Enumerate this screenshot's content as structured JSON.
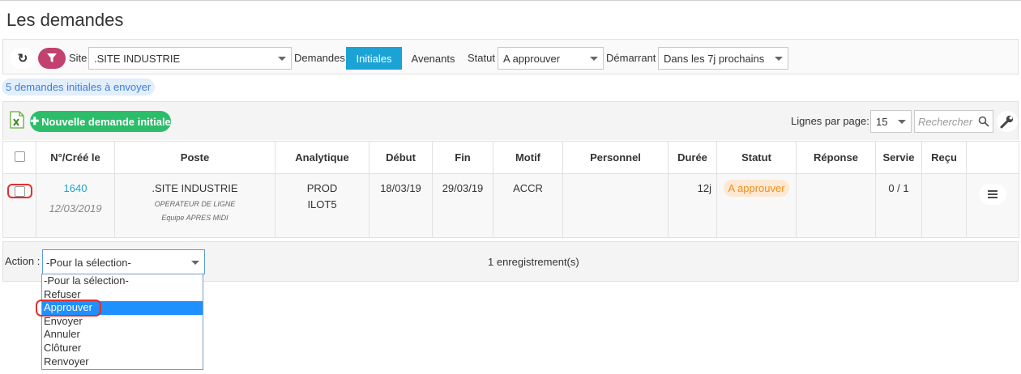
{
  "page": {
    "title": "Les demandes"
  },
  "filters": {
    "site_label": "Site",
    "site_value": ".SITE INDUSTRIE",
    "demandes_label": "Demandes",
    "tab_initiales": "Initiales",
    "tab_avenants": "Avenants",
    "statut_label": "Statut",
    "statut_value": "A approuver",
    "demarrant_label": "Démarrant",
    "demarrant_value": "Dans les 7j prochains"
  },
  "summary": {
    "count_badge": "5 demandes initiales à envoyer"
  },
  "toolbar": {
    "new_button": "Nouvelle demande initiale",
    "rows_per_page_label": "Lignes par page:",
    "rows_per_page_value": "15",
    "search_placeholder": "Rechercher"
  },
  "table": {
    "headers": [
      "N°/Créé le",
      "Poste",
      "Analytique",
      "Début",
      "Fin",
      "Motif",
      "Personnel",
      "Durée",
      "Statut",
      "Réponse",
      "Servie",
      "Reçu"
    ],
    "rows": [
      {
        "number": "1640",
        "created": "12/03/2019",
        "poste_site": ".SITE INDUSTRIE",
        "poste_role": "OPERATEUR DE LIGNE",
        "poste_team": "Equipe APRES MIDI",
        "analytique_1": "PROD",
        "analytique_2": "ILOT5",
        "debut": "18/03/19",
        "fin": "29/03/19",
        "motif": "ACCR",
        "personnel": "",
        "duree": "12j",
        "statut": "A approuver",
        "reponse": "",
        "servie": "0 / 1",
        "recu": ""
      }
    ]
  },
  "footer": {
    "action_label": "Action :",
    "action_value": "-Pour la sélection-",
    "records": "1 enregistrement(s)"
  },
  "action_options": [
    "-Pour la sélection-",
    "Refuser",
    "Approuver",
    "Envoyer",
    "Annuler",
    "Clôturer",
    "Renvoyer"
  ],
  "colors": {
    "accent_blue": "#1ba3d6",
    "filter_pink": "#c2416e",
    "new_green": "#2bbd6a",
    "status_orange": "#f0901e",
    "highlight_red": "#e03030"
  }
}
